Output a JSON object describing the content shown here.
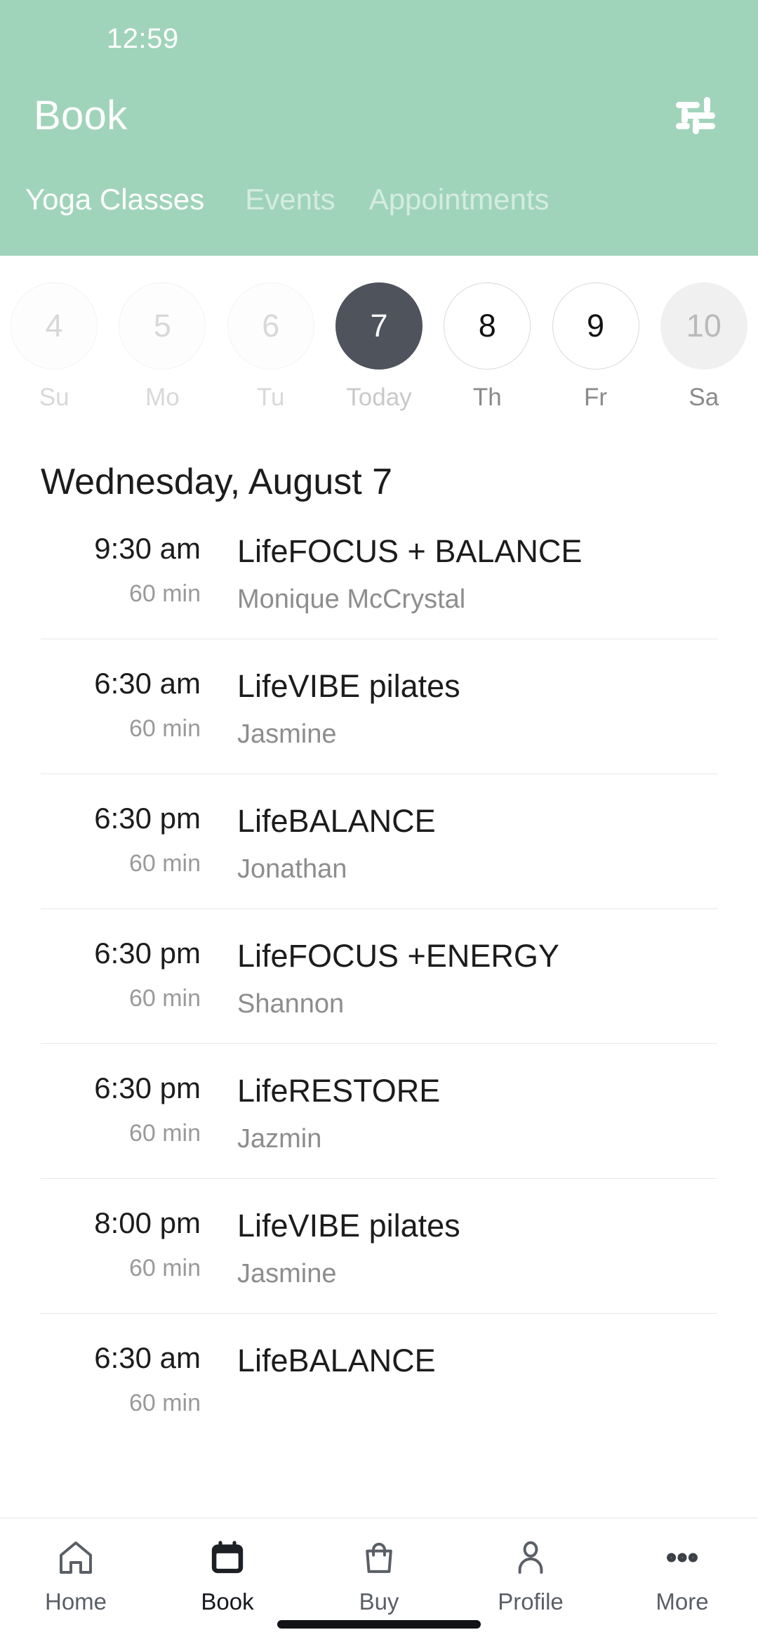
{
  "status_bar": {
    "time": "12:59"
  },
  "header": {
    "title": "Book",
    "filter_icon": "sliders-icon",
    "accent_color": "#a0d4ba",
    "tabs": [
      {
        "label": "Yoga Classes",
        "active": true
      },
      {
        "label": "Events",
        "active": false
      },
      {
        "label": "Appointments",
        "active": false
      }
    ]
  },
  "date_strip": [
    {
      "day": "4",
      "weekday": "Su",
      "state": "past"
    },
    {
      "day": "5",
      "weekday": "Mo",
      "state": "past"
    },
    {
      "day": "6",
      "weekday": "Tu",
      "state": "past"
    },
    {
      "day": "7",
      "weekday": "Today",
      "state": "today"
    },
    {
      "day": "8",
      "weekday": "Th",
      "state": "future"
    },
    {
      "day": "9",
      "weekday": "Fr",
      "state": "future"
    },
    {
      "day": "10",
      "weekday": "Sa",
      "state": "faded"
    }
  ],
  "schedule": {
    "heading": "Wednesday, August 7",
    "classes": [
      {
        "time": "9:30 am",
        "duration": "60 min",
        "name": "LifeFOCUS + BALANCE",
        "teacher": "Monique McCrystal"
      },
      {
        "time": "6:30 am",
        "duration": "60 min",
        "name": "LifeVIBE pilates",
        "teacher": "Jasmine"
      },
      {
        "time": "6:30 pm",
        "duration": "60 min",
        "name": "LifeBALANCE",
        "teacher": "Jonathan"
      },
      {
        "time": "6:30 pm",
        "duration": "60 min",
        "name": "LifeFOCUS +ENERGY",
        "teacher": "Shannon"
      },
      {
        "time": "6:30 pm",
        "duration": "60 min",
        "name": "LifeRESTORE",
        "teacher": "Jazmin"
      },
      {
        "time": "8:00 pm",
        "duration": "60 min",
        "name": "LifeVIBE pilates",
        "teacher": "Jasmine"
      },
      {
        "time": "6:30 am",
        "duration": "60 min",
        "name": "LifeBALANCE",
        "teacher": ""
      }
    ]
  },
  "bottom_nav": [
    {
      "label": "Home",
      "icon": "home-icon",
      "active": false
    },
    {
      "label": "Book",
      "icon": "calendar-icon",
      "active": true
    },
    {
      "label": "Buy",
      "icon": "bag-icon",
      "active": false
    },
    {
      "label": "Profile",
      "icon": "person-icon",
      "active": false
    },
    {
      "label": "More",
      "icon": "ellipsis-icon",
      "active": false
    }
  ]
}
